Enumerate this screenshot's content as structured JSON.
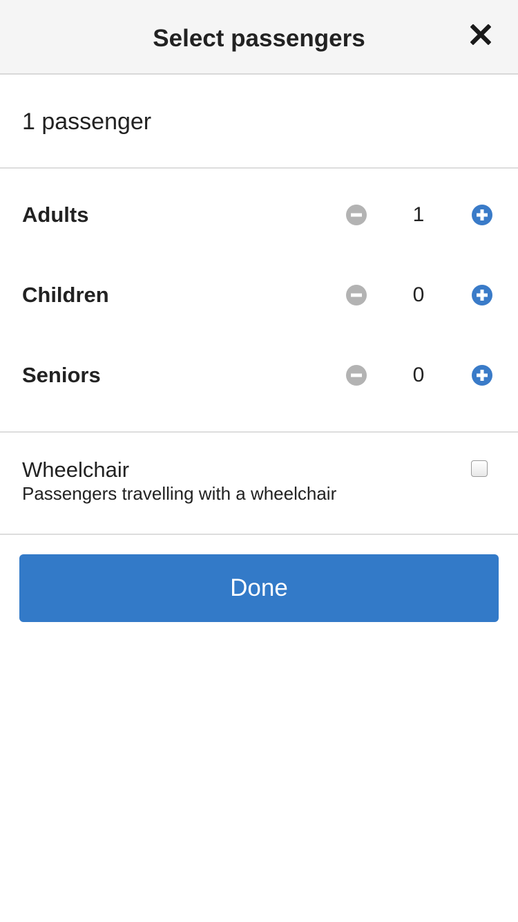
{
  "header": {
    "title": "Select passengers",
    "close_icon": "close-icon"
  },
  "summary": {
    "text": "1 passenger"
  },
  "counters": [
    {
      "label": "Adults",
      "value": "1"
    },
    {
      "label": "Children",
      "value": "0"
    },
    {
      "label": "Seniors",
      "value": "0"
    }
  ],
  "wheelchair": {
    "title": "Wheelchair",
    "description": "Passengers travelling with a wheelchair",
    "checked": false
  },
  "done_button": {
    "label": "Done"
  },
  "colors": {
    "accent": "#337ac8",
    "minus_disabled": "#b3b3b3",
    "plus": "#3a7bc8",
    "header_bg": "#f5f5f5"
  }
}
